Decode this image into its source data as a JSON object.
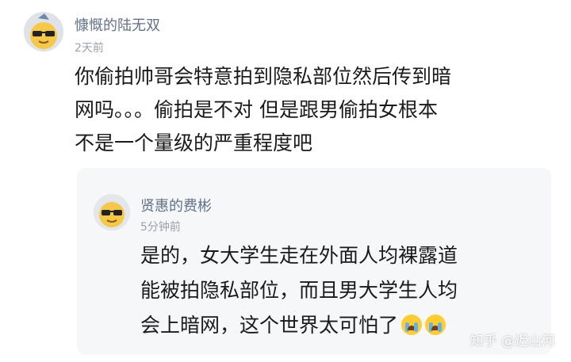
{
  "comment": {
    "username": "慷慨的陆无双",
    "timestamp": "2天前",
    "lines": [
      "你偷拍帅哥会特意拍到隐私部位然后传到暗",
      "网吗。。。偷拍是不对 但是跟男偷拍女根本",
      "不是一个量级的严重程度吧"
    ]
  },
  "reply": {
    "username": "贤惠的费彬",
    "timestamp": "5分钟前",
    "lines": [
      "是的，女大学生走在外面人均裸露道",
      "能被拍隐私部位，而且男大学生人均",
      "会上暗网，这个世界太可怕了"
    ],
    "emoji_icons": [
      "crying-face-icon",
      "crying-face-icon"
    ]
  },
  "watermark": "知乎 @迟山河",
  "colors": {
    "username": "#62708a",
    "timestamp": "#9aa1ab",
    "text": "#1a1a1a",
    "reply_background": "#f6f7f9"
  }
}
